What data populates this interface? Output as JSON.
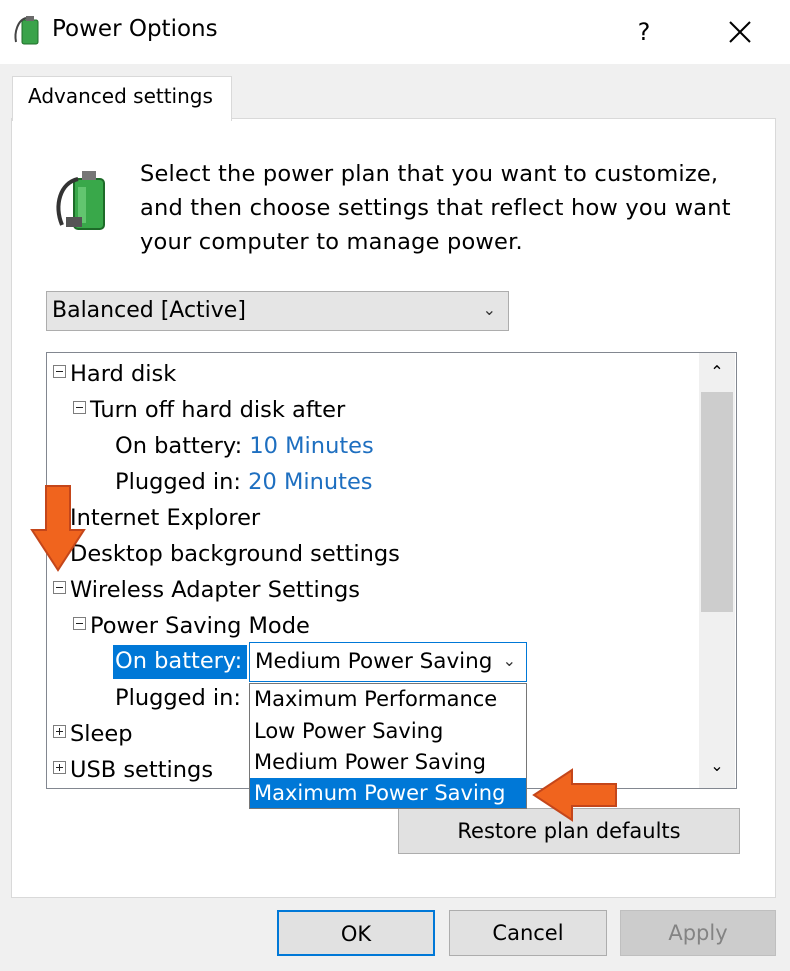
{
  "window": {
    "title": "Power Options",
    "help": "?",
    "close": "✕"
  },
  "tab": {
    "label": "Advanced settings"
  },
  "description": "Select the power plan that you want to customize, and then choose settings that reflect how you want your computer to manage power.",
  "plan_select": {
    "value": "Balanced [Active]"
  },
  "tree": {
    "hard_disk": "Hard disk",
    "turn_off": "Turn off hard disk after",
    "hd_on_battery_label": "On battery:",
    "hd_on_battery_value": "10 Minutes",
    "hd_plugged_label": "Plugged in:",
    "hd_plugged_value": "20 Minutes",
    "internet_explorer": "Internet Explorer",
    "desktop_bg": "Desktop background settings",
    "wireless": "Wireless Adapter Settings",
    "power_saving_mode": "Power Saving Mode",
    "ps_on_battery_label": "On battery:",
    "ps_plugged_label": "Plugged in:",
    "sleep": "Sleep",
    "usb": "USB settings"
  },
  "combo": {
    "value": "Medium Power Saving",
    "options": [
      "Maximum Performance",
      "Low Power Saving",
      "Medium Power Saving",
      "Maximum Power Saving"
    ],
    "highlighted": "Maximum Power Saving"
  },
  "buttons": {
    "restore": "Restore plan defaults",
    "ok": "OK",
    "cancel": "Cancel",
    "apply": "Apply"
  },
  "colors": {
    "accent": "#0078d7",
    "value_link": "#1e6fc0",
    "annotation_arrow": "#f0641e"
  }
}
